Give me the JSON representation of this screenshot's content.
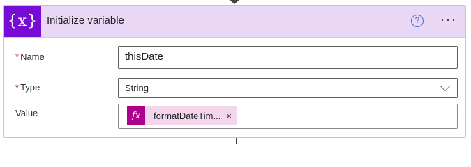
{
  "action": {
    "icon_text": "{x}",
    "title": "Initialize variable",
    "help_glyph": "?",
    "more_glyph": "···",
    "header_color": "#e9d7f5",
    "icon_color": "#770bd6"
  },
  "fields": {
    "name": {
      "required_mark": "*",
      "label": "Name",
      "value": "thisDate"
    },
    "type": {
      "required_mark": "*",
      "label": "Type",
      "value": "String"
    },
    "value": {
      "label": "Value",
      "token": {
        "icon_text": "fx",
        "text": "formatDateTim...",
        "close_glyph": "×",
        "color": "#ad008c"
      }
    }
  }
}
